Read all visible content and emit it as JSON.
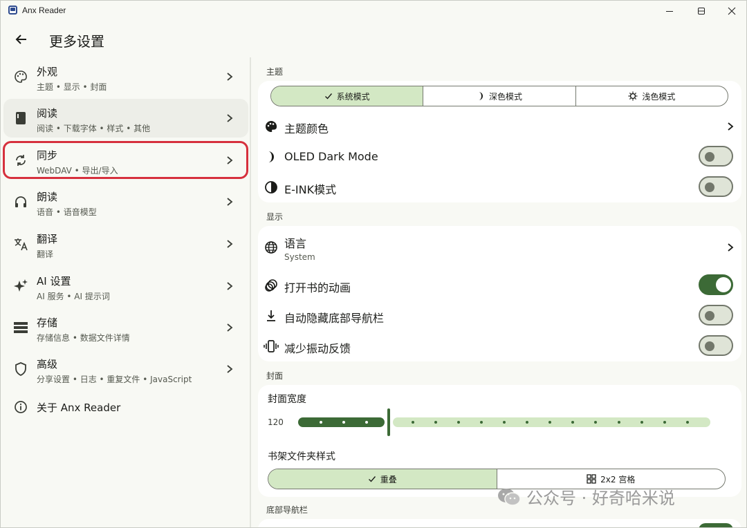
{
  "window": {
    "title": "Anx Reader"
  },
  "header": {
    "title": "更多设置"
  },
  "sidebar": {
    "items": [
      {
        "label": "外观",
        "subtitle": "主题 • 显示 • 封面",
        "icon": "palette-icon"
      },
      {
        "label": "阅读",
        "subtitle": "阅读 • 下载字体 • 样式 • 其他",
        "icon": "book-icon"
      },
      {
        "label": "同步",
        "subtitle": "WebDAV • 导出/导入",
        "icon": "sync-icon"
      },
      {
        "label": "朗读",
        "subtitle": "语音 • 语音模型",
        "icon": "headphones-icon"
      },
      {
        "label": "翻译",
        "subtitle": "翻译",
        "icon": "translate-icon"
      },
      {
        "label": "AI 设置",
        "subtitle": "AI 服务 • AI 提示词",
        "icon": "sparkle-icon"
      },
      {
        "label": "存储",
        "subtitle": "存储信息 • 数据文件详情",
        "icon": "storage-icon"
      },
      {
        "label": "高级",
        "subtitle": "分享设置 • 日志 • 重复文件 • JavaScript",
        "icon": "shield-icon"
      },
      {
        "label": "关于 Anx Reader",
        "icon": "info-icon"
      }
    ]
  },
  "theme_section": {
    "title": "主题",
    "modes": [
      {
        "label": "系统模式",
        "icon": "check-icon",
        "active": true
      },
      {
        "label": "深色模式",
        "icon": "moon-icon",
        "active": false
      },
      {
        "label": "浅色模式",
        "icon": "sun-icon",
        "active": false
      }
    ],
    "rows": {
      "theme_color": "主题颜色",
      "oled": "OLED Dark Mode",
      "eink": "E-INK模式"
    },
    "toggles": {
      "oled": false,
      "eink": false
    }
  },
  "display_section": {
    "title": "显示",
    "language_label": "语言",
    "language_value": "System",
    "open_animation": "打开书的动画",
    "auto_hide_nav": "自动隐藏底部导航栏",
    "reduce_vibration": "减少振动反馈",
    "toggles": {
      "open_animation": true,
      "auto_hide_nav": false,
      "reduce_vibration": false
    }
  },
  "cover_section": {
    "title": "封面",
    "width_label": "封面宽度",
    "width_value": "120",
    "width_fraction": 0.22,
    "folder_style_label": "书架文件夹样式",
    "folder_styles": [
      {
        "label": "重叠",
        "icon": "check-icon",
        "active": true
      },
      {
        "label": "2x2 宫格",
        "icon": "grid-icon",
        "active": false
      }
    ]
  },
  "bottom_nav_section": {
    "title": "底部导航栏"
  },
  "watermark": {
    "text": "公众号 · 好奇哈米说"
  },
  "colors": {
    "accent": "#3c6a36",
    "accent_container": "#d3e8c4",
    "highlight": "#d6303d"
  }
}
